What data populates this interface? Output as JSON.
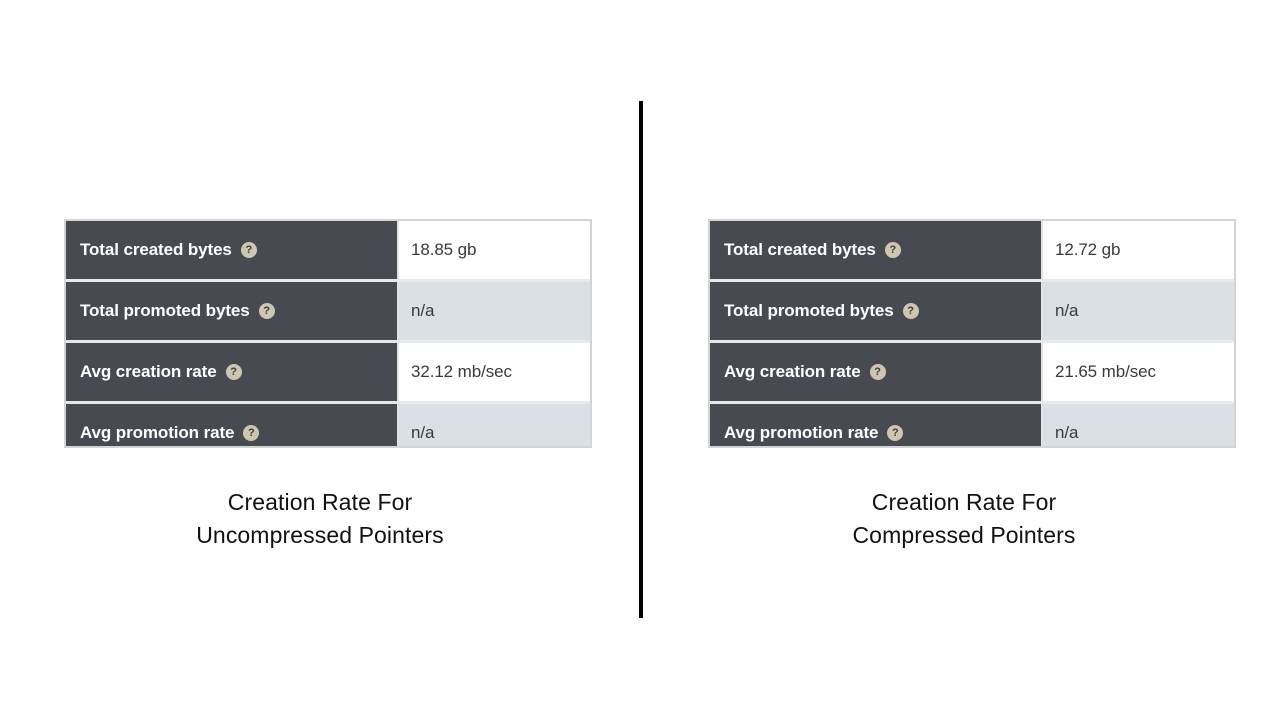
{
  "divider": {
    "orientation": "vertical",
    "color": "#000000"
  },
  "colors": {
    "label_background": "#474b51",
    "label_text": "#ffffff",
    "value_text": "#3a3a3a",
    "value_row_alt": "#dae1e6",
    "value_row_default": "#ffffff",
    "table_border": "#d4d4d4",
    "help_icon_background": "#cfc6b1",
    "help_icon_glyph": "#3d3d3d",
    "caption_text": "#111111"
  },
  "panels": [
    {
      "id": "uncompressed-pointers",
      "caption_lines": [
        "Creation Rate For",
        "Uncompressed Pointers"
      ],
      "table": {
        "rows": [
          {
            "label": "Total created bytes",
            "help": "?",
            "value": "18.85 gb",
            "shaded": false
          },
          {
            "label": "Total promoted bytes",
            "help": "?",
            "value": "n/a",
            "shaded": true
          },
          {
            "label": "Avg creation rate",
            "help": "?",
            "value": "32.12 mb/sec",
            "shaded": false
          },
          {
            "label": "Avg promotion rate",
            "help": "?",
            "value": "n/a",
            "shaded": true
          }
        ]
      }
    },
    {
      "id": "compressed-pointers",
      "caption_lines": [
        "Creation Rate For",
        "Compressed Pointers"
      ],
      "table": {
        "rows": [
          {
            "label": "Total created bytes",
            "help": "?",
            "value": "12.72 gb",
            "shaded": false
          },
          {
            "label": "Total promoted bytes",
            "help": "?",
            "value": "n/a",
            "shaded": true
          },
          {
            "label": "Avg creation rate",
            "help": "?",
            "value": "21.65 mb/sec",
            "shaded": false
          },
          {
            "label": "Avg promotion rate",
            "help": "?",
            "value": "n/a",
            "shaded": true
          }
        ]
      }
    }
  ]
}
